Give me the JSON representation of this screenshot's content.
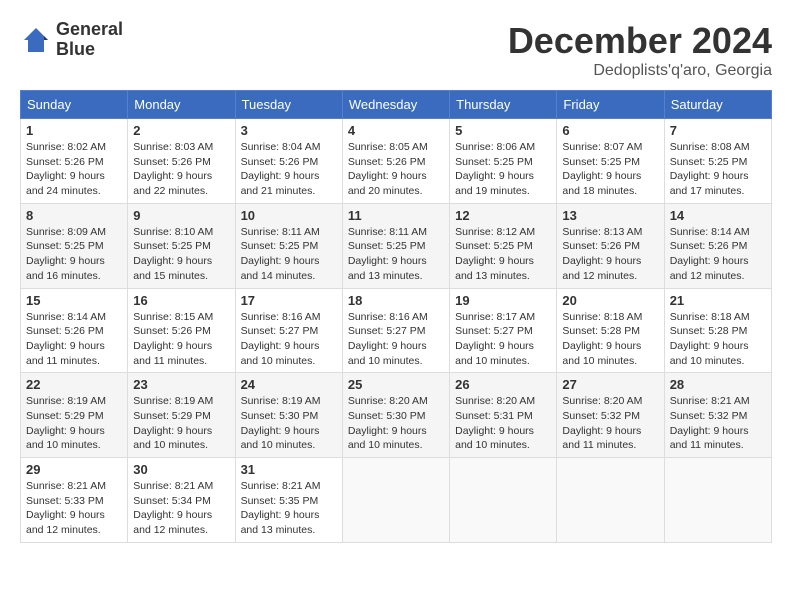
{
  "header": {
    "logo_line1": "General",
    "logo_line2": "Blue",
    "month": "December 2024",
    "location": "Dedoplists'q'aro, Georgia"
  },
  "weekdays": [
    "Sunday",
    "Monday",
    "Tuesday",
    "Wednesday",
    "Thursday",
    "Friday",
    "Saturday"
  ],
  "weeks": [
    [
      {
        "day": "1",
        "sunrise": "8:02 AM",
        "sunset": "5:26 PM",
        "daylight": "9 hours and 24 minutes."
      },
      {
        "day": "2",
        "sunrise": "8:03 AM",
        "sunset": "5:26 PM",
        "daylight": "9 hours and 22 minutes."
      },
      {
        "day": "3",
        "sunrise": "8:04 AM",
        "sunset": "5:26 PM",
        "daylight": "9 hours and 21 minutes."
      },
      {
        "day": "4",
        "sunrise": "8:05 AM",
        "sunset": "5:26 PM",
        "daylight": "9 hours and 20 minutes."
      },
      {
        "day": "5",
        "sunrise": "8:06 AM",
        "sunset": "5:25 PM",
        "daylight": "9 hours and 19 minutes."
      },
      {
        "day": "6",
        "sunrise": "8:07 AM",
        "sunset": "5:25 PM",
        "daylight": "9 hours and 18 minutes."
      },
      {
        "day": "7",
        "sunrise": "8:08 AM",
        "sunset": "5:25 PM",
        "daylight": "9 hours and 17 minutes."
      }
    ],
    [
      {
        "day": "8",
        "sunrise": "8:09 AM",
        "sunset": "5:25 PM",
        "daylight": "9 hours and 16 minutes."
      },
      {
        "day": "9",
        "sunrise": "8:10 AM",
        "sunset": "5:25 PM",
        "daylight": "9 hours and 15 minutes."
      },
      {
        "day": "10",
        "sunrise": "8:11 AM",
        "sunset": "5:25 PM",
        "daylight": "9 hours and 14 minutes."
      },
      {
        "day": "11",
        "sunrise": "8:11 AM",
        "sunset": "5:25 PM",
        "daylight": "9 hours and 13 minutes."
      },
      {
        "day": "12",
        "sunrise": "8:12 AM",
        "sunset": "5:25 PM",
        "daylight": "9 hours and 13 minutes."
      },
      {
        "day": "13",
        "sunrise": "8:13 AM",
        "sunset": "5:26 PM",
        "daylight": "9 hours and 12 minutes."
      },
      {
        "day": "14",
        "sunrise": "8:14 AM",
        "sunset": "5:26 PM",
        "daylight": "9 hours and 12 minutes."
      }
    ],
    [
      {
        "day": "15",
        "sunrise": "8:14 AM",
        "sunset": "5:26 PM",
        "daylight": "9 hours and 11 minutes."
      },
      {
        "day": "16",
        "sunrise": "8:15 AM",
        "sunset": "5:26 PM",
        "daylight": "9 hours and 11 minutes."
      },
      {
        "day": "17",
        "sunrise": "8:16 AM",
        "sunset": "5:27 PM",
        "daylight": "9 hours and 10 minutes."
      },
      {
        "day": "18",
        "sunrise": "8:16 AM",
        "sunset": "5:27 PM",
        "daylight": "9 hours and 10 minutes."
      },
      {
        "day": "19",
        "sunrise": "8:17 AM",
        "sunset": "5:27 PM",
        "daylight": "9 hours and 10 minutes."
      },
      {
        "day": "20",
        "sunrise": "8:18 AM",
        "sunset": "5:28 PM",
        "daylight": "9 hours and 10 minutes."
      },
      {
        "day": "21",
        "sunrise": "8:18 AM",
        "sunset": "5:28 PM",
        "daylight": "9 hours and 10 minutes."
      }
    ],
    [
      {
        "day": "22",
        "sunrise": "8:19 AM",
        "sunset": "5:29 PM",
        "daylight": "9 hours and 10 minutes."
      },
      {
        "day": "23",
        "sunrise": "8:19 AM",
        "sunset": "5:29 PM",
        "daylight": "9 hours and 10 minutes."
      },
      {
        "day": "24",
        "sunrise": "8:19 AM",
        "sunset": "5:30 PM",
        "daylight": "9 hours and 10 minutes."
      },
      {
        "day": "25",
        "sunrise": "8:20 AM",
        "sunset": "5:30 PM",
        "daylight": "9 hours and 10 minutes."
      },
      {
        "day": "26",
        "sunrise": "8:20 AM",
        "sunset": "5:31 PM",
        "daylight": "9 hours and 10 minutes."
      },
      {
        "day": "27",
        "sunrise": "8:20 AM",
        "sunset": "5:32 PM",
        "daylight": "9 hours and 11 minutes."
      },
      {
        "day": "28",
        "sunrise": "8:21 AM",
        "sunset": "5:32 PM",
        "daylight": "9 hours and 11 minutes."
      }
    ],
    [
      {
        "day": "29",
        "sunrise": "8:21 AM",
        "sunset": "5:33 PM",
        "daylight": "9 hours and 12 minutes."
      },
      {
        "day": "30",
        "sunrise": "8:21 AM",
        "sunset": "5:34 PM",
        "daylight": "9 hours and 12 minutes."
      },
      {
        "day": "31",
        "sunrise": "8:21 AM",
        "sunset": "5:35 PM",
        "daylight": "9 hours and 13 minutes."
      },
      null,
      null,
      null,
      null
    ]
  ]
}
